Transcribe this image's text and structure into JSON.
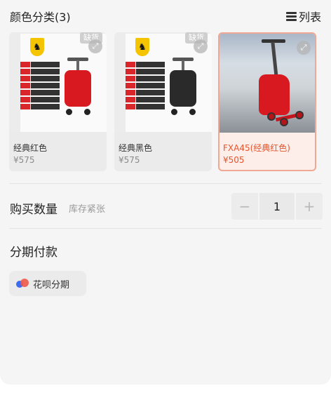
{
  "color_section": {
    "title": "颜色分类(3)",
    "list_toggle_label": "列表",
    "options": [
      {
        "name": "经典红色",
        "price": "¥575",
        "badge": "缺货",
        "case_color": "#d8191f",
        "selected": false
      },
      {
        "name": "经典黑色",
        "price": "¥575",
        "badge": "缺货",
        "case_color": "#2a2a2a",
        "selected": false
      },
      {
        "name": "FXA45(经典红色)",
        "price": "¥505",
        "selected": true
      }
    ]
  },
  "quantity": {
    "label": "购买数量",
    "stock_note": "库存紧张",
    "minus": "−",
    "value": "1",
    "plus": "+"
  },
  "installment": {
    "title": "分期付款",
    "option_label": "花呗分期"
  },
  "colors": {
    "accent": "#e5542d",
    "selected_border": "#f0a793",
    "selected_bg": "#fdeee9"
  }
}
